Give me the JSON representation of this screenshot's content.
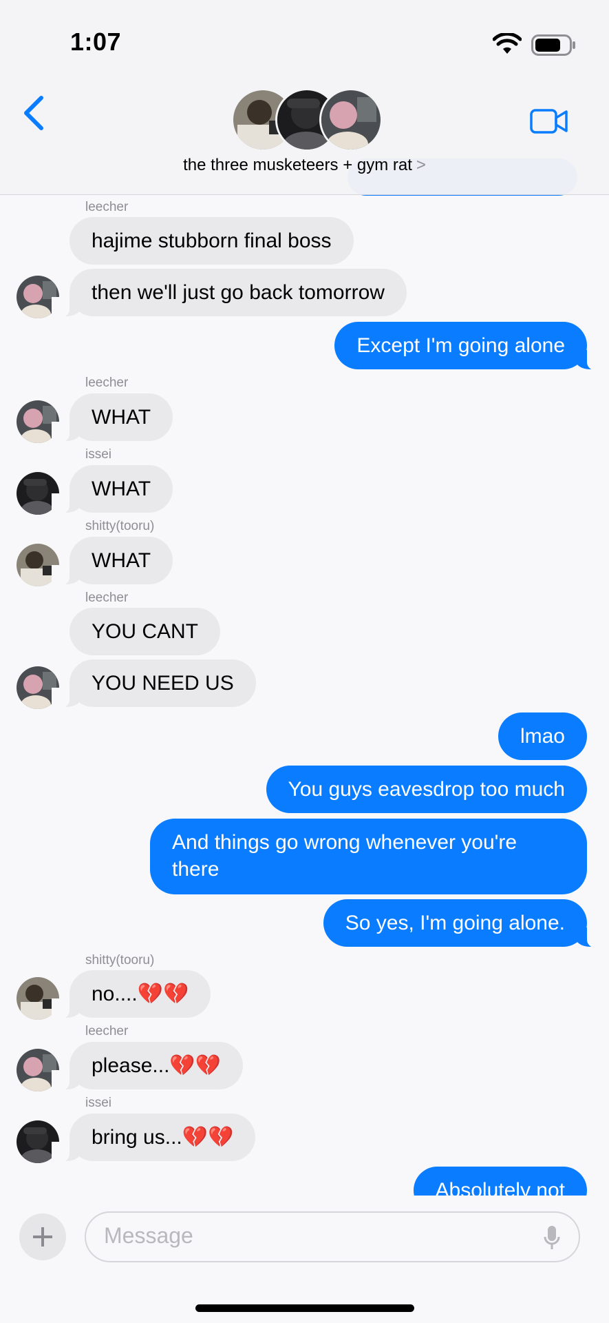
{
  "status_bar": {
    "time": "1:07"
  },
  "header": {
    "title": "the three musketeers + gym rat",
    "chevron": ">"
  },
  "messages": {
    "m1_sender": "leecher",
    "m1": "hajime stubborn final boss",
    "m2": "then we'll just go back tomorrow",
    "m3": "Except I'm going alone",
    "m4_sender": "leecher",
    "m4": "WHAT",
    "m5_sender": "issei",
    "m5": "WHAT",
    "m6_sender": "shitty(tooru)",
    "m6": "WHAT",
    "m7_sender": "leecher",
    "m7": "YOU CANT",
    "m8": "YOU NEED US",
    "m9": "lmao",
    "m10": "You guys eavesdrop too much",
    "m11_line1": "And things go wrong whenever you're",
    "m11_line2": "there",
    "m12": "So yes, I'm going alone.",
    "m13_sender": "shitty(tooru)",
    "m13": "no....💔💔",
    "m14_sender": "leecher",
    "m14": "please...💔💔",
    "m15_sender": "issei",
    "m15": "bring us...💔💔",
    "m16": "Absolutely not"
  },
  "composer": {
    "placeholder": "Message"
  },
  "colors": {
    "outgoing": "#0a7cff",
    "incoming": "#e9e9eb",
    "accent": "#0a7cff"
  },
  "icons": [
    "back-chevron-icon",
    "video-call-icon",
    "plus-icon",
    "microphone-icon",
    "wifi-icon",
    "battery-icon"
  ]
}
